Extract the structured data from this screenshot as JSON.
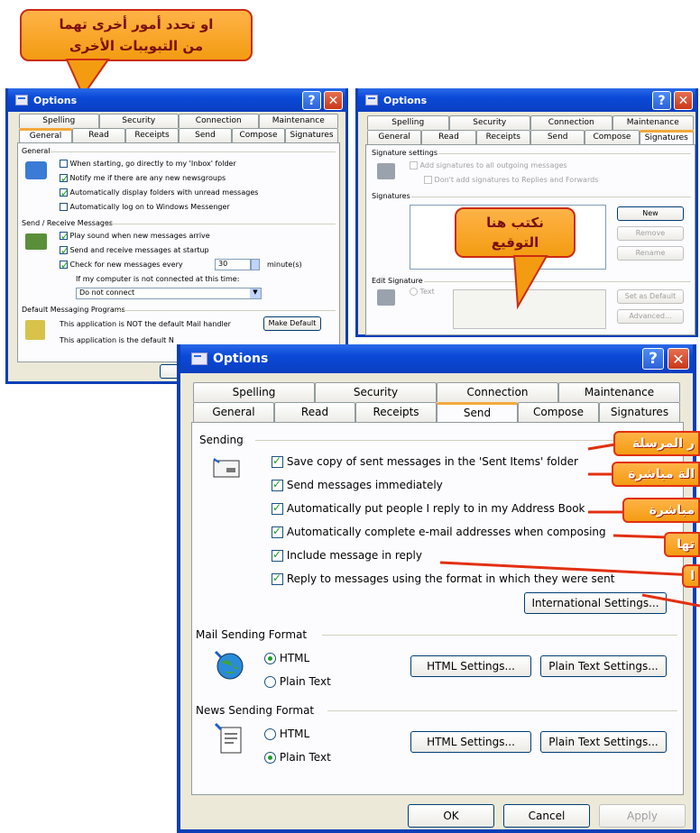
{
  "callouts": {
    "top_line1": "او تحدد أمور أخرى تهما",
    "top_line2": "من التبويبات الأخرى",
    "signature_line1": "نكتب هنا",
    "signature_line2": "التوقيع",
    "side": [
      "ر المرسلة",
      "الة مباشرة",
      "مباشرة",
      "تها",
      "ا"
    ]
  },
  "dialog_general": {
    "title": "Options",
    "tabs_top": [
      "Spelling",
      "Security",
      "Connection",
      "Maintenance"
    ],
    "tabs_bottom": [
      "General",
      "Read",
      "Receipts",
      "Send",
      "Compose",
      "Signatures"
    ],
    "active_tab": "General",
    "group_general": "General",
    "options": [
      {
        "label": "When starting, go directly to my 'Inbox' folder",
        "checked": false
      },
      {
        "label": "Notify me if there are any new newsgroups",
        "checked": true
      },
      {
        "label": "Automatically display folders with unread messages",
        "checked": true
      },
      {
        "label": "Automatically log on to Windows Messenger",
        "checked": false
      }
    ],
    "group_send_receive": "Send / Receive Messages",
    "sr_options": [
      {
        "label": "Play sound when new messages arrive",
        "checked": true
      },
      {
        "label": "Send and receive messages at startup",
        "checked": true
      }
    ],
    "check_every_label": "Check for new messages every",
    "check_every_value": "30",
    "check_every_unit": "minute(s)",
    "not_connected_label": "If my computer is not connected at this time:",
    "not_connected_value": "Do not connect",
    "group_default": "Default Messaging Programs",
    "default_mail": "This application is NOT the default Mail handler",
    "make_default": "Make Default",
    "default_news": "This application is the default N"
  },
  "dialog_signatures": {
    "title": "Options",
    "tabs_top": [
      "Spelling",
      "Security",
      "Connection",
      "Maintenance"
    ],
    "tabs_bottom": [
      "General",
      "Read",
      "Receipts",
      "Send",
      "Compose",
      "Signatures"
    ],
    "active_tab": "Signatures",
    "group_settings": "Signature settings",
    "opt_add": "Add signatures to all outgoing messages",
    "opt_dont": "Don't add signatures to Replies and Forwards",
    "group_signatures": "Signatures",
    "btn_new": "New",
    "btn_remove": "Remove",
    "btn_rename": "Rename",
    "group_edit": "Edit Signature",
    "opt_text": "Text",
    "btn_set_default": "Set as Default",
    "btn_advanced": "Advanced..."
  },
  "dialog_send": {
    "title": "Options",
    "tabs_top": [
      "Spelling",
      "Security",
      "Connection",
      "Maintenance"
    ],
    "tabs_bottom": [
      "General",
      "Read",
      "Receipts",
      "Send",
      "Compose",
      "Signatures"
    ],
    "active_tab": "Send",
    "group_sending": "Sending",
    "sending_options": [
      {
        "label": "Save copy of sent messages in the 'Sent Items' folder",
        "checked": true
      },
      {
        "label": "Send messages immediately",
        "checked": true
      },
      {
        "label": "Automatically put people I reply to in my Address Book",
        "checked": true
      },
      {
        "label": "Automatically complete e-mail addresses when composing",
        "checked": true
      },
      {
        "label": "Include message in reply",
        "checked": true
      },
      {
        "label": "Reply to messages using the format in which they were sent",
        "checked": true
      }
    ],
    "btn_international": "International Settings...",
    "group_mail_format": "Mail Sending Format",
    "mail_html": "HTML",
    "mail_plain": "Plain Text",
    "mail_selected": "HTML",
    "group_news_format": "News Sending Format",
    "news_html": "HTML",
    "news_plain": "Plain Text",
    "news_selected": "Plain Text",
    "btn_html_settings": "HTML Settings...",
    "btn_plain_settings": "Plain Text Settings...",
    "btn_ok": "OK",
    "btn_cancel": "Cancel",
    "btn_apply": "Apply"
  },
  "colors": {
    "xp_blue": "#0a49d8",
    "dialog_bg": "#ece9d8",
    "callout_orange": "#f39c12",
    "callout_border": "#cc2b14"
  }
}
